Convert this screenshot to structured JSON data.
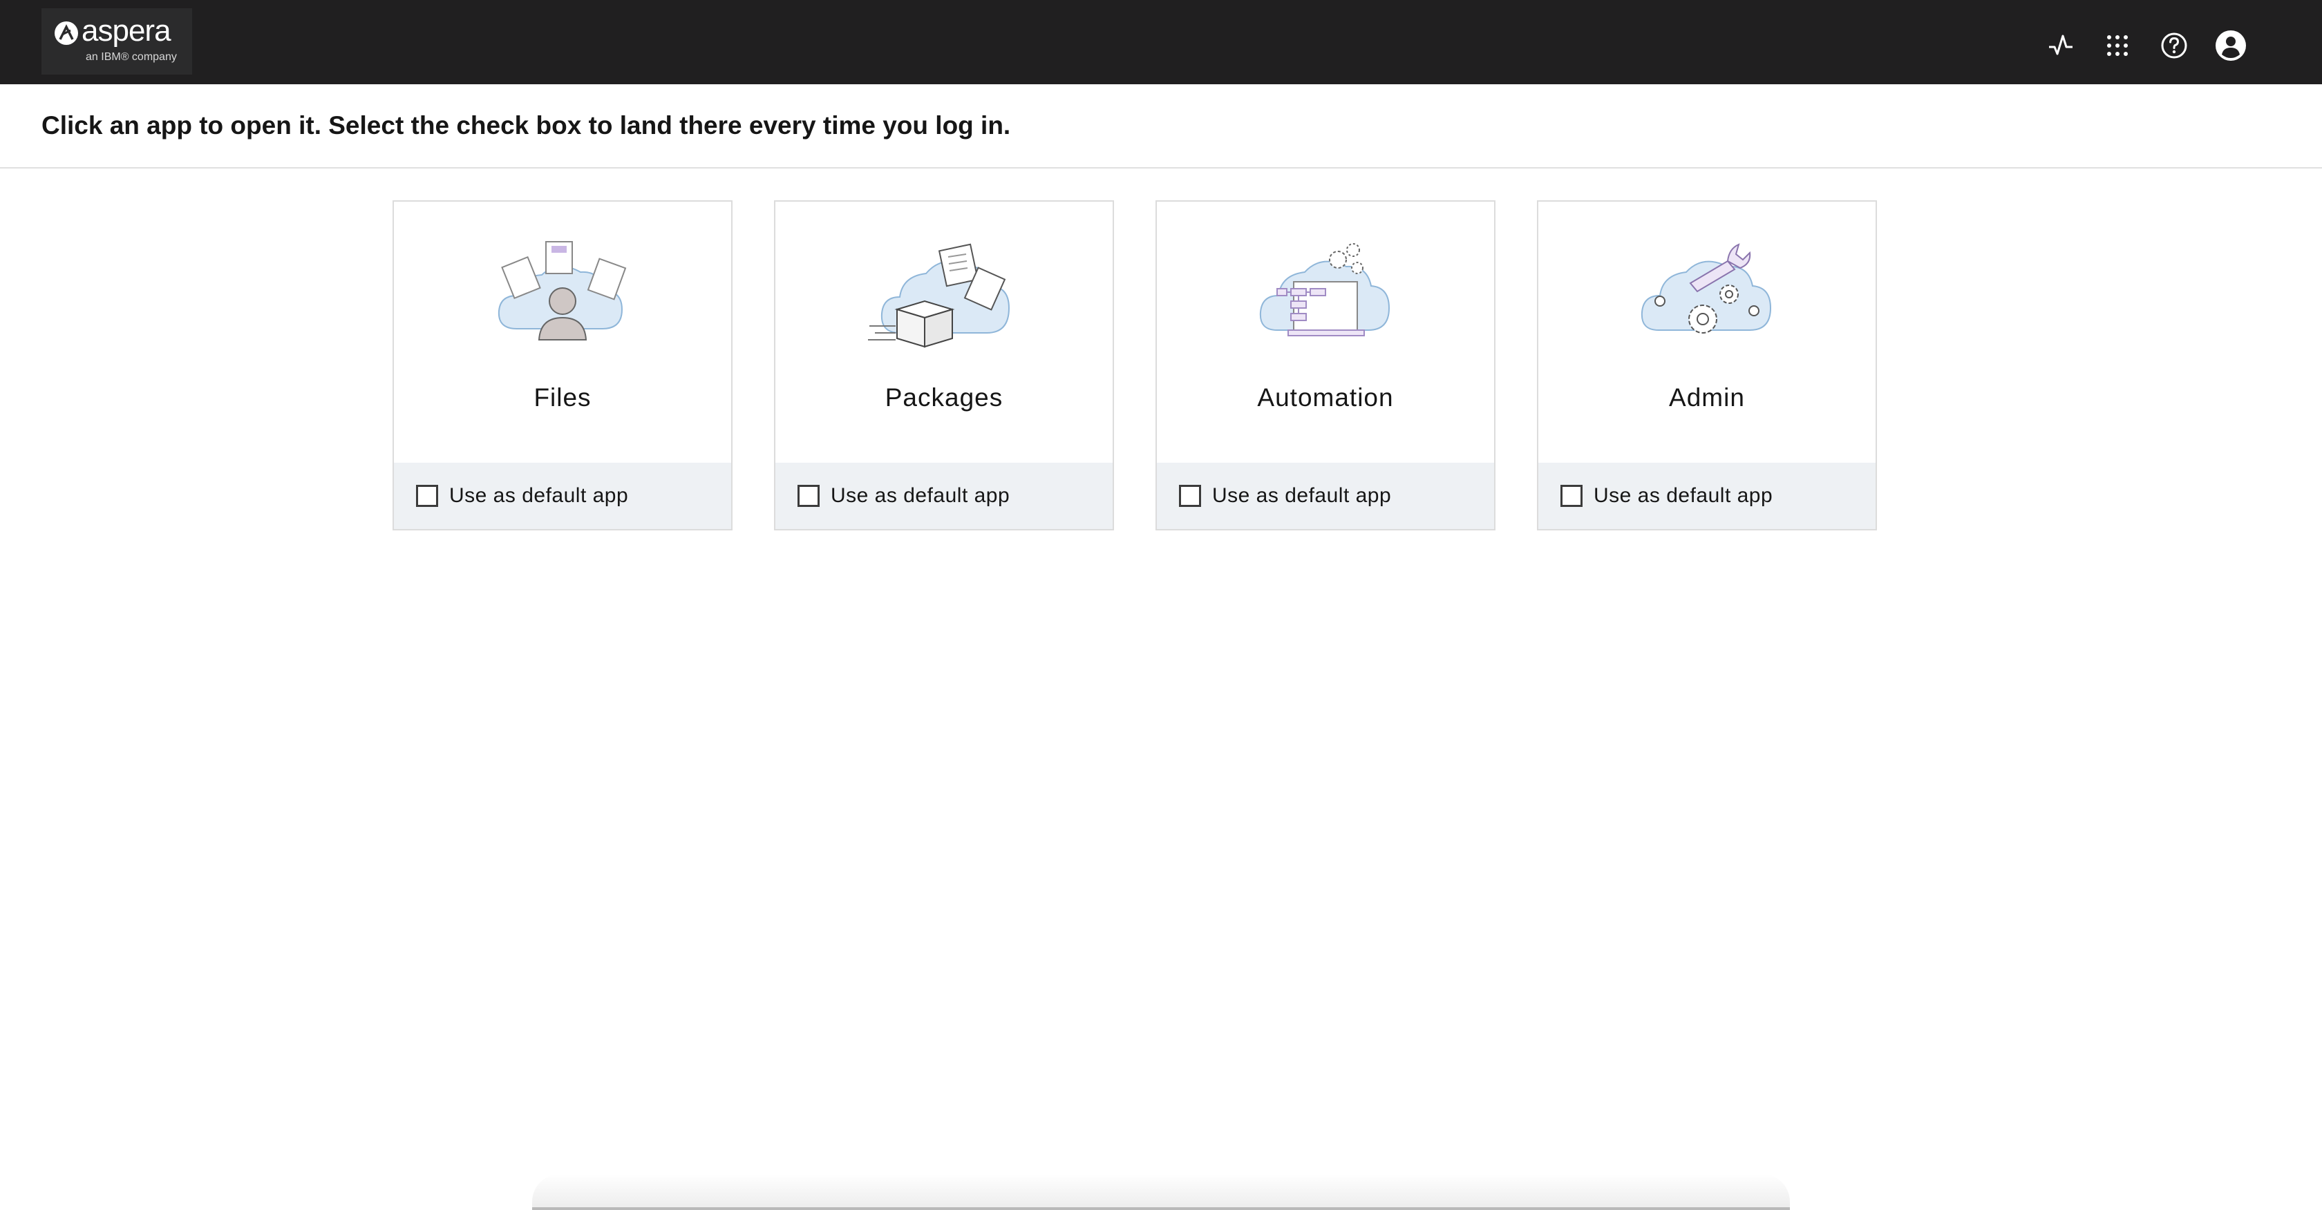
{
  "header": {
    "brand": "aspera",
    "brand_sub": "an IBM® company",
    "icons": [
      "activity-icon",
      "app-switcher-icon",
      "help-icon",
      "user-avatar-icon"
    ]
  },
  "instruction": "Click an app to open it. Select the check box to land there every time you log in.",
  "apps": [
    {
      "name": "Files",
      "checkbox_label": "Use as default app",
      "checked": false,
      "icon": "files-illustration"
    },
    {
      "name": "Packages",
      "checkbox_label": "Use as default app",
      "checked": false,
      "icon": "packages-illustration"
    },
    {
      "name": "Automation",
      "checkbox_label": "Use as default app",
      "checked": false,
      "icon": "automation-illustration"
    },
    {
      "name": "Admin",
      "checkbox_label": "Use as default app",
      "checked": false,
      "icon": "admin-illustration"
    }
  ],
  "colors": {
    "header_bg": "#201f20",
    "tile_footer_bg": "#eef1f4",
    "illustration_blue": "#dbe9f6",
    "illustration_purple": "#c9b6e4"
  }
}
